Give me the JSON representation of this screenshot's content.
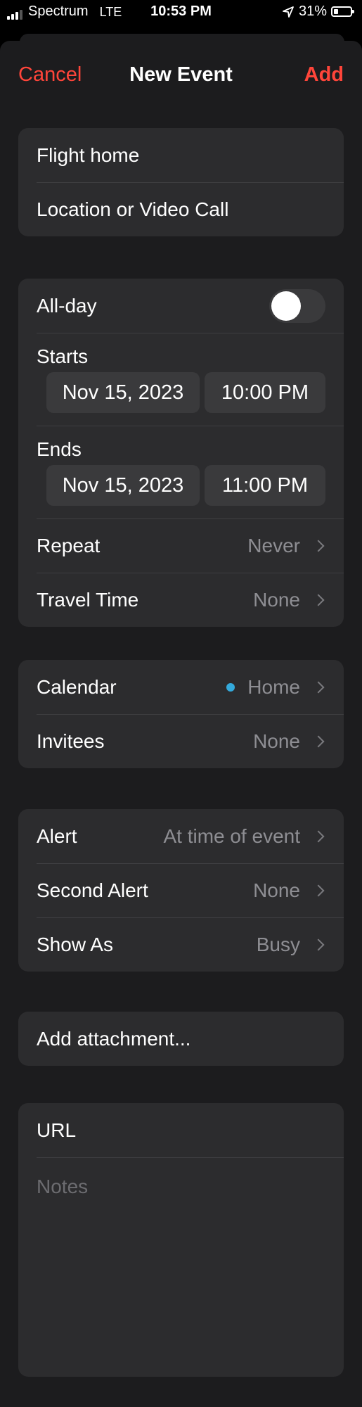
{
  "status_bar": {
    "carrier": "Spectrum",
    "network": "LTE",
    "time": "10:53 PM",
    "battery": "31%"
  },
  "nav": {
    "cancel": "Cancel",
    "title": "New Event",
    "add": "Add"
  },
  "event": {
    "title": "Flight home",
    "location_placeholder": "Location or Video Call"
  },
  "schedule": {
    "all_day_label": "All-day",
    "all_day_on": false,
    "starts_label": "Starts",
    "start_date": "Nov 15, 2023",
    "start_time": "10:00 PM",
    "ends_label": "Ends",
    "end_date": "Nov 15, 2023",
    "end_time": "11:00 PM",
    "repeat_label": "Repeat",
    "repeat_value": "Never",
    "travel_label": "Travel Time",
    "travel_value": "None"
  },
  "calendar": {
    "calendar_label": "Calendar",
    "calendar_value": "Home",
    "calendar_color": "#34aadc",
    "invitees_label": "Invitees",
    "invitees_value": "None"
  },
  "alerts": {
    "alert_label": "Alert",
    "alert_value": "At time of event",
    "second_alert_label": "Second Alert",
    "second_alert_value": "None",
    "show_as_label": "Show As",
    "show_as_value": "Busy"
  },
  "attachment": {
    "label": "Add attachment..."
  },
  "extras": {
    "url_placeholder": "URL",
    "notes_placeholder": "Notes"
  },
  "colors": {
    "accent": "#ff453a",
    "background": "#1c1c1e",
    "cell": "#2c2c2e"
  }
}
